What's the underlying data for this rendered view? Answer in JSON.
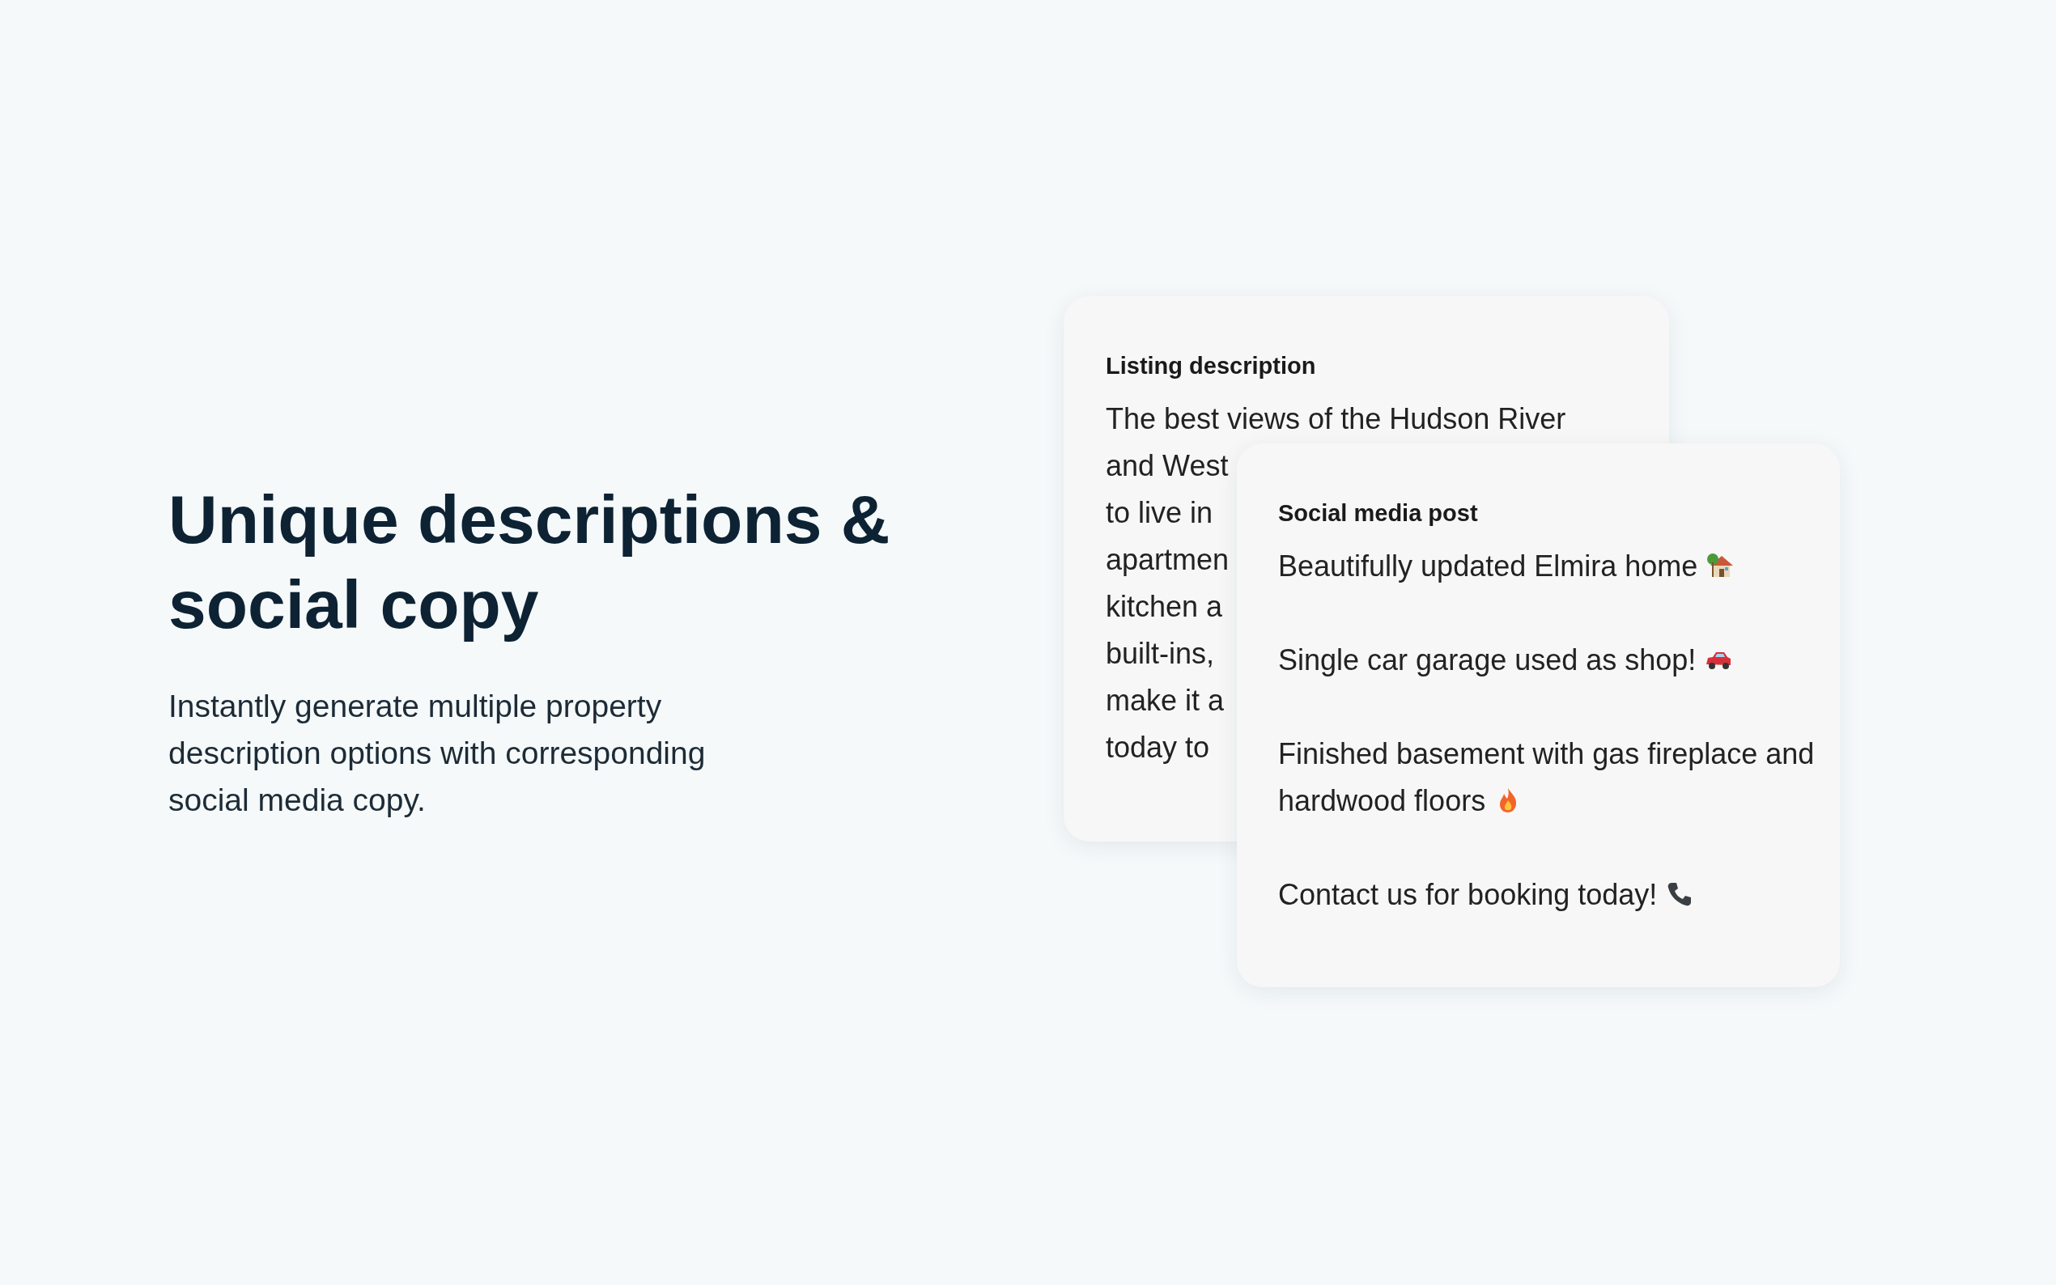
{
  "heading": "Unique descriptions & social copy",
  "subtitle": "Instantly generate multiple property description options with corresponding social media copy.",
  "listing_card": {
    "title": "Listing description",
    "lines": [
      "The best views of the Hudson River",
      "and West",
      "to live in",
      "apartmen",
      "kitchen a",
      "built-ins,",
      "make it a",
      "today to"
    ]
  },
  "social_card": {
    "title": "Social media post",
    "posts": [
      "Beautifully updated Elmira home",
      "Single car garage used as shop!",
      "Finished basement with gas fireplace and hardwood floors",
      "Contact us for booking today!"
    ]
  }
}
